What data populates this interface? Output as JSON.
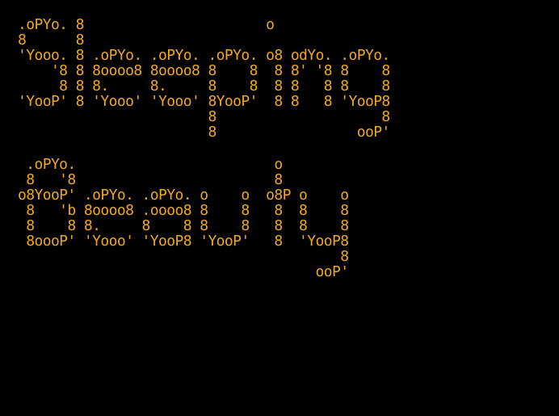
{
  "theme": {
    "background": "#000000",
    "foreground": "#F0A81E"
  },
  "terminal": {
    "banner_1": ".oPYo. 8                      o\n8      8\n'Yooo. 8 .oPYo. .oPYo. .oPYo. o8 odYo. .oPYo.\n    '8 8 8oooo8 8oooo8 8    8  8 8' '8 8    8\n     8 8 8.     8.     8    8  8 8   8 8    8\n'YooP' 8 'Yooo' 'Yooo' 8YooP'  8 8   8 'YooP8\n                       8                    8\n                       8                 ooP'",
    "banner_2": " .oPYo.                        o\n 8   '8                        8\no8YooP' .oPYo. .oPYo. o    o  o8P o    o\n 8   'b 8oooo8 .oooo8 8    8   8  8    8\n 8    8 8.     8    8 8    8   8  8    8\n 8oooP' 'Yooo' 'YooP8 'YooP'   8  'YooP8\n                                       8\n                                    ooP'"
  }
}
